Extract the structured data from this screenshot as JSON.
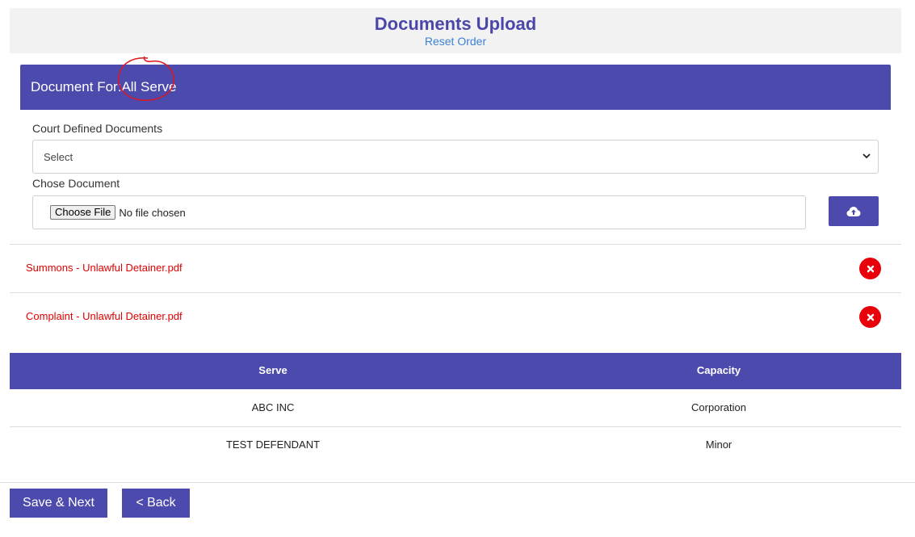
{
  "header": {
    "title": "Documents Upload",
    "reset_label": "Reset Order"
  },
  "panel": {
    "label": "Document For:",
    "value": "All Serve"
  },
  "court_docs": {
    "label": "Court Defined Documents",
    "selected": "Select"
  },
  "choose_doc": {
    "label": "Chose Document",
    "button": "Choose File",
    "status": "No file chosen"
  },
  "documents": [
    {
      "name": "Summons - Unlawful Detainer.pdf"
    },
    {
      "name": "Complaint - Unlawful Detainer.pdf"
    }
  ],
  "table": {
    "headers": [
      "Serve",
      "Capacity"
    ],
    "rows": [
      {
        "serve": "ABC INC",
        "capacity": "Corporation"
      },
      {
        "serve": "TEST DEFENDANT",
        "capacity": "Minor"
      }
    ]
  },
  "footer": {
    "save_label": "Save & Next",
    "back_label": "< Back"
  },
  "colors": {
    "primary": "#4d4aad",
    "title": "#4b47a8",
    "link": "#3b82d6",
    "danger": "#e8000b",
    "doc_text": "#e00000",
    "annotation": "#e0141e"
  },
  "icons": {
    "upload": "cloud-upload-icon",
    "delete": "close-circle-icon",
    "dropdown": "chevron-down-icon"
  }
}
